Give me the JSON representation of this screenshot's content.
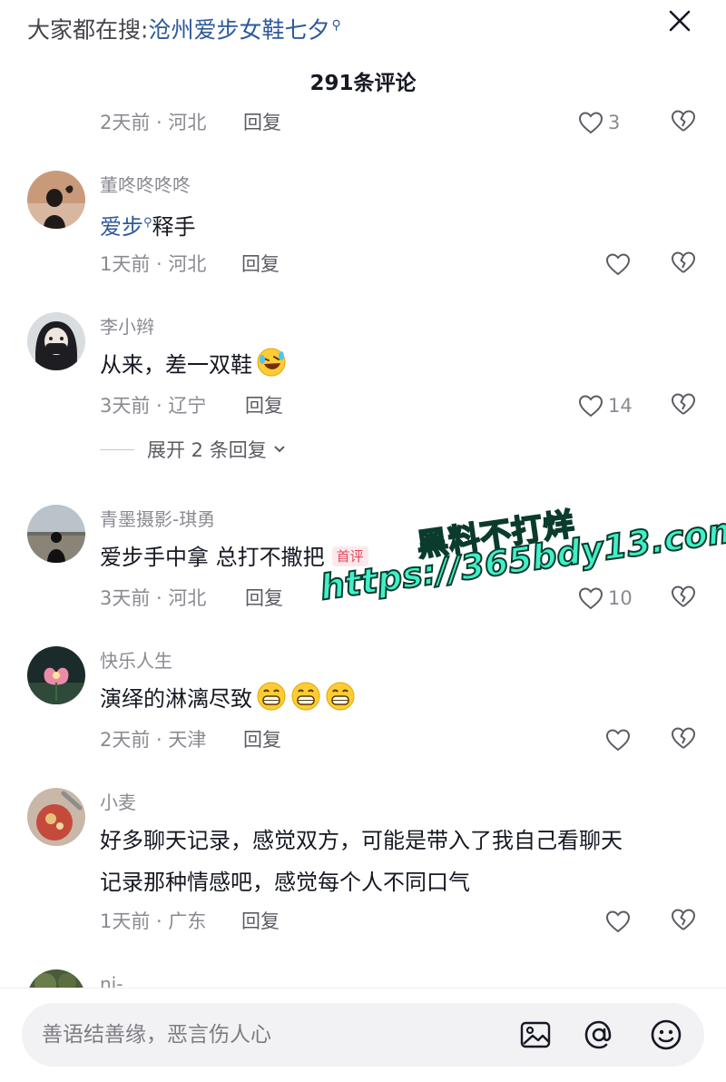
{
  "header": {
    "search_prefix": "大家都在搜:",
    "search_term": "沧州爱步女鞋七夕",
    "search_icon": "search-icon",
    "close_icon": "close-icon"
  },
  "comment_count": "291条评论",
  "comments": [
    {
      "username": "",
      "text": "",
      "time": "2天前",
      "location": "河北",
      "reply": "回复",
      "likes": "3"
    },
    {
      "username": "董咚咚咚咚",
      "text_keyword": "爱步",
      "text_rest": "释手",
      "time": "1天前",
      "location": "河北",
      "reply": "回复",
      "likes": ""
    },
    {
      "username": "李小辫",
      "text": "从来，差一双鞋",
      "emoji": "rolling-laughing-emoji",
      "time": "3天前",
      "location": "辽宁",
      "reply": "回复",
      "likes": "14",
      "expand": "展开 2 条回复"
    },
    {
      "username": "青墨摄影-琪勇",
      "text": "爱步手中拿 总打不撒把",
      "badge": "首评",
      "time": "3天前",
      "location": "河北",
      "reply": "回复",
      "likes": "10"
    },
    {
      "username": "快乐人生",
      "text": "演绎的淋漓尽致",
      "emoji": "grinning-emoji",
      "time": "2天前",
      "location": "天津",
      "reply": "回复",
      "likes": ""
    },
    {
      "username": "小麦",
      "text_line1": "好多聊天记录，感觉双方，可能是带入了我自己看聊天",
      "text_line2": "记录那种情感吧，感觉每个人不同口气",
      "time": "1天前",
      "location": "广东",
      "reply": "回复",
      "likes": ""
    },
    {
      "username": "ni-"
    }
  ],
  "watermark": {
    "line1": "黑料不打烊",
    "line2": "https://365bdy13.com"
  },
  "bottom": {
    "placeholder": "善语结善缘，恶言伤人心",
    "icons": [
      "image-icon",
      "at-icon",
      "emoji-icon"
    ]
  },
  "colors": {
    "keyword": "#2e5a9c",
    "muted": "#8a8b91",
    "badge": "#e4475a",
    "watermark": "#3ff0c8"
  }
}
